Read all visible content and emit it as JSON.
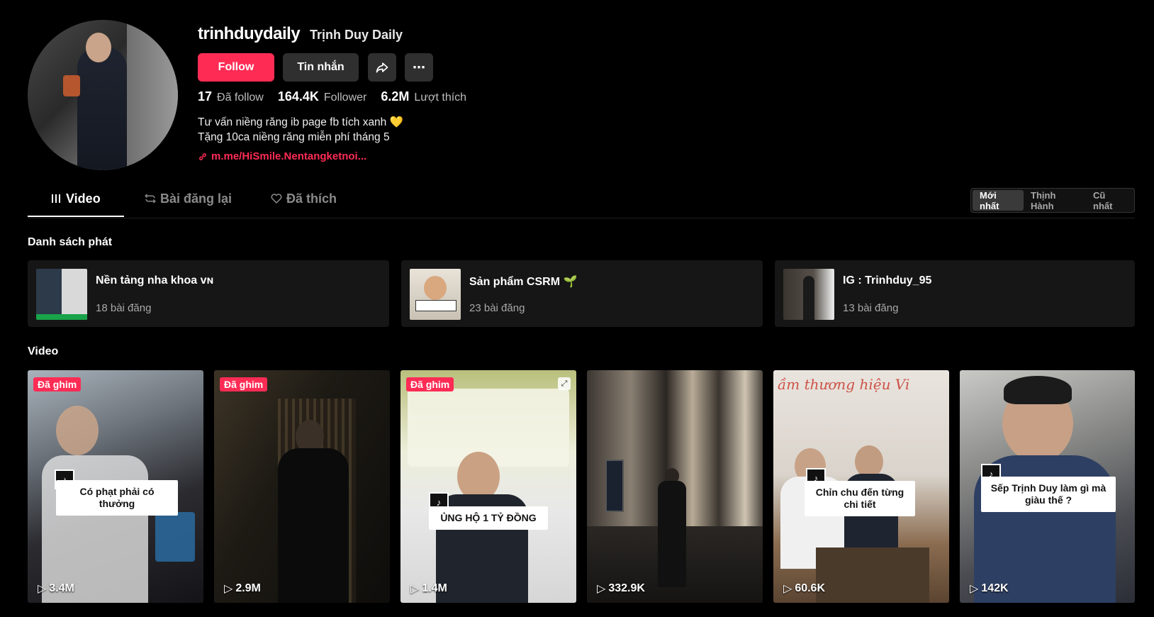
{
  "profile": {
    "username": "trinhduydaily",
    "display_name": "Trịnh Duy Daily",
    "follow_label": "Follow",
    "message_label": "Tin nhắn",
    "stats": [
      {
        "value": "17",
        "label": "Đã follow"
      },
      {
        "value": "164.4K",
        "label": "Follower"
      },
      {
        "value": "6.2M",
        "label": "Lượt thích"
      }
    ],
    "bio_line1": "Tư vấn niềng răng ib page fb tích xanh 💛",
    "bio_line2": "Tặng 10ca niềng răng miễn phí tháng 5",
    "link": "m.me/HiSmile.Nentangketnoi..."
  },
  "tabs": [
    {
      "label": "Video",
      "icon": "grid-icon"
    },
    {
      "label": "Bài đăng lại",
      "icon": "repost-icon"
    },
    {
      "label": "Đã thích",
      "icon": "heart-icon"
    }
  ],
  "sort": {
    "options": [
      "Mới nhất",
      "Thịnh Hành",
      "Cũ nhất"
    ],
    "selected": "Mới nhất"
  },
  "playlists": {
    "title": "Danh sách phát",
    "items": [
      {
        "name": "Nền tảng nha khoa ᴠɴ",
        "count": "18 bài đăng"
      },
      {
        "name": "Sản phẩm CSRM 🌱",
        "count": "23 bài đăng"
      },
      {
        "name": "IG : Trinhduy_95",
        "count": "13 bài đăng"
      }
    ]
  },
  "videos": {
    "title": "Video",
    "pinned_label": "Đã ghim",
    "items": [
      {
        "views": "3.4M",
        "caption": "Có phạt phải có thưởng",
        "pinned": true
      },
      {
        "views": "2.9M",
        "caption": "",
        "pinned": true
      },
      {
        "views": "1.4M",
        "caption": "ỦNG HỘ 1 TỶ ĐỒNG",
        "pinned": true
      },
      {
        "views": "332.9K",
        "caption": "",
        "pinned": false
      },
      {
        "views": "60.6K",
        "caption": "Chỉn chu đến từng chi tiết",
        "pinned": false
      },
      {
        "views": "142K",
        "caption": "Sếp Trịnh Duy làm gì mà giàu thế ?",
        "pinned": false
      }
    ]
  },
  "colors": {
    "accent": "#fe2c55",
    "background": "#000000",
    "button_dark": "#2f2f2f"
  }
}
